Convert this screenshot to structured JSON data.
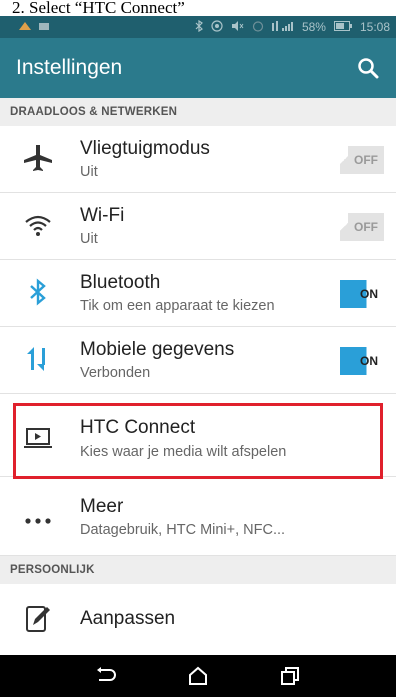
{
  "caption": "2. Select “HTC Connect”",
  "status_bar": {
    "battery": "58%",
    "time": "15:08"
  },
  "app_bar": {
    "title": "Instellingen"
  },
  "sections": {
    "wireless": "DRAADLOOS & NETWERKEN",
    "personal": "PERSOONLIJK"
  },
  "rows": [
    {
      "label": "Vliegtuigmodus",
      "sub": "Uit",
      "toggle": "OFF",
      "icon": "airplane-icon"
    },
    {
      "label": "Wi-Fi",
      "sub": "Uit",
      "toggle": "OFF",
      "icon": "wifi-icon"
    },
    {
      "label": "Bluetooth",
      "sub": "Tik om een apparaat te kiezen",
      "toggle": "ON",
      "icon": "bluetooth-icon"
    },
    {
      "label": "Mobiele gegevens",
      "sub": "Verbonden",
      "toggle": "ON",
      "icon": "mobile-data-icon"
    },
    {
      "label": "HTC Connect",
      "sub": "Kies waar je media wilt afspelen",
      "icon": "htc-connect-icon"
    },
    {
      "label": "Meer",
      "sub": "Datagebruik, HTC Mini+, NFC...",
      "icon": "more-dots-icon"
    },
    {
      "label": "Aanpassen",
      "icon": "personalize-icon"
    }
  ],
  "colors": {
    "app_bar": "#2b7a8c",
    "status_bar": "#1f5f6e",
    "toggle_on": "#2a9fd8",
    "highlight": "#e0202c"
  }
}
